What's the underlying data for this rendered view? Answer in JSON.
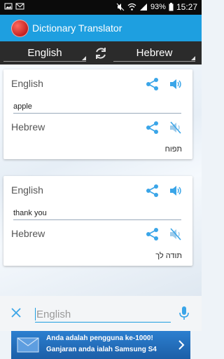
{
  "status_bar": {
    "battery": "93%",
    "time": "15:27"
  },
  "app_bar": {
    "title": "Dictionary Translator"
  },
  "language_bar": {
    "source_language": "English",
    "target_language": "Hebrew",
    "swap_icon": "swap-icon"
  },
  "cards": [
    {
      "source_language": "English",
      "input_text": "apple",
      "target_language": "Hebrew",
      "output_text": "תפוח"
    },
    {
      "source_language": "English",
      "input_text": "thank you",
      "target_language": "Hebrew",
      "output_text": "תודה לך"
    }
  ],
  "input_bar": {
    "placeholder": "English"
  },
  "ad": {
    "line1": "Anda adalah pengguna ke-1000!",
    "line2": "Ganjaran anda ialah Samsung S4"
  },
  "colors": {
    "app_bar": "#1e9fe0",
    "language_bar": "#2b2b2b",
    "icon_blue": "#3aa5e8",
    "ad_blue": "#2c7fd0"
  }
}
